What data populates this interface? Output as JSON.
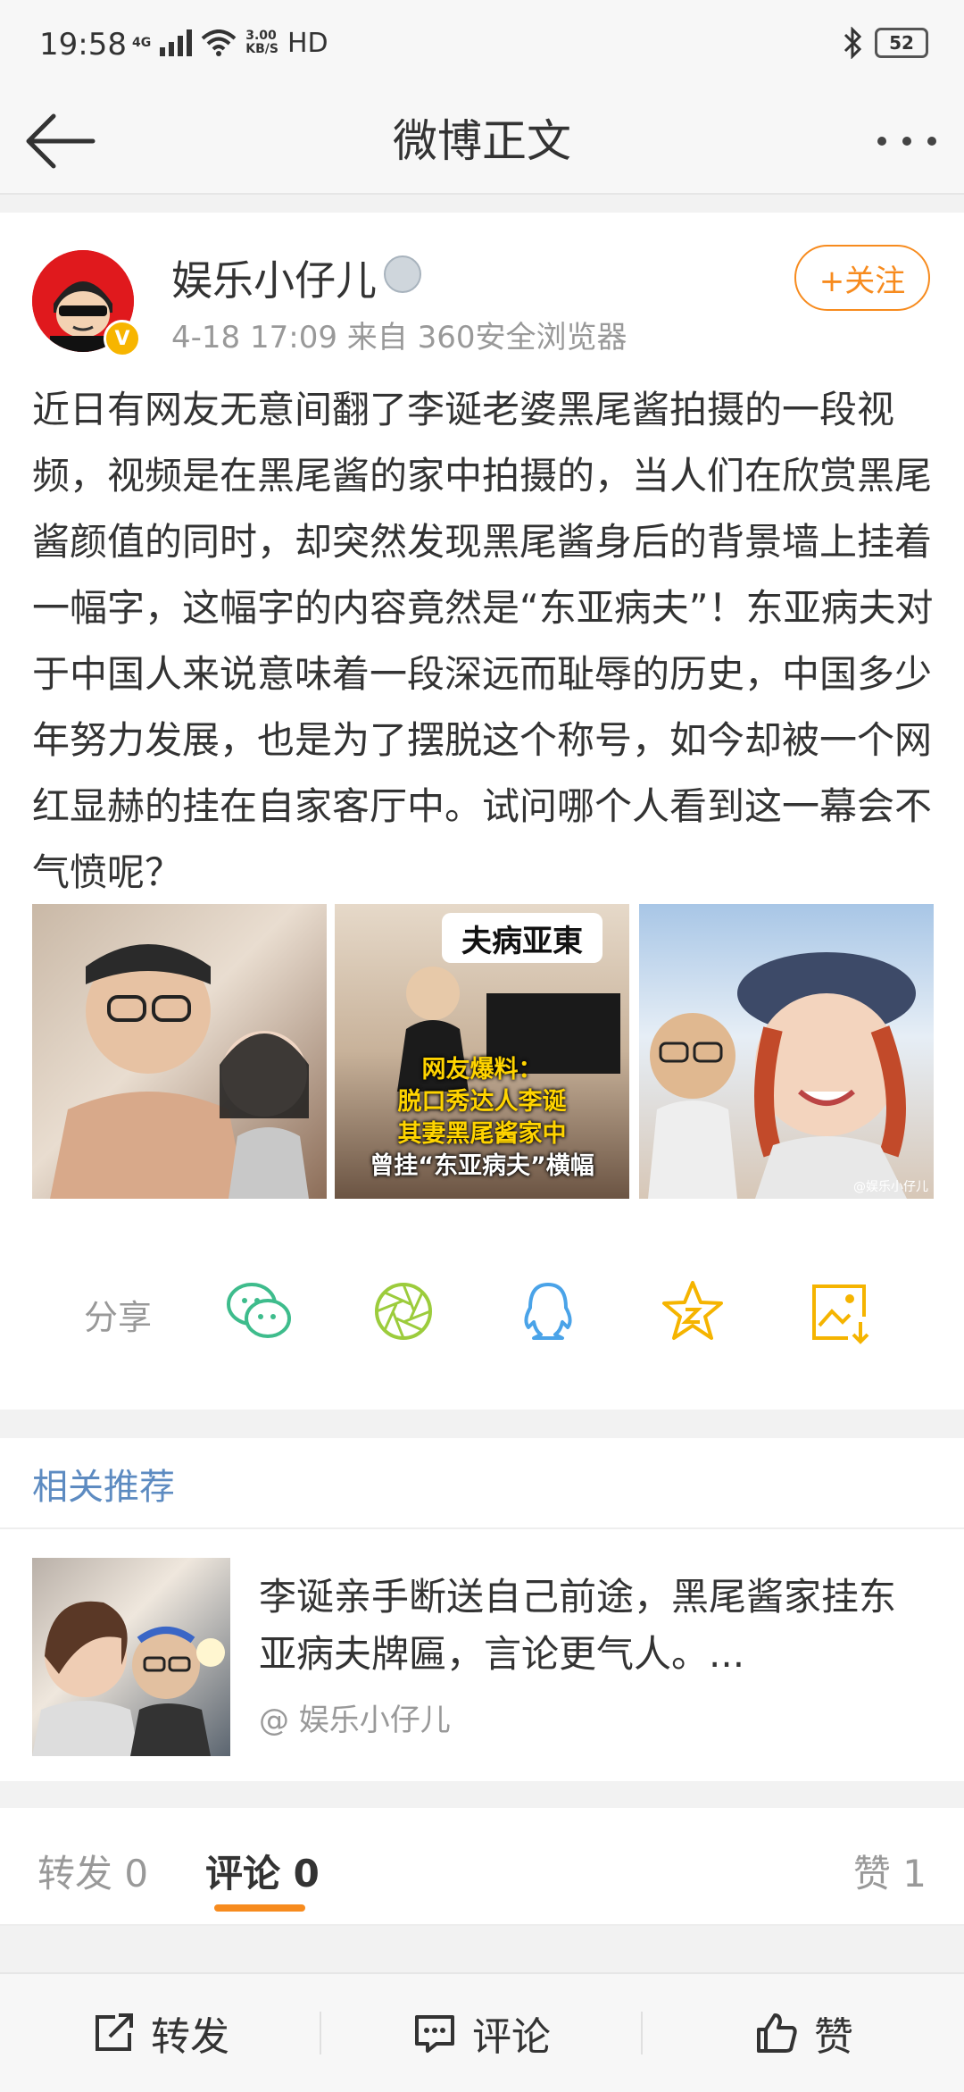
{
  "status_bar": {
    "time": "19:58",
    "network": "4G",
    "speed_value": "3.00",
    "speed_unit": "KB/S",
    "hd": "HD",
    "battery": "52"
  },
  "nav": {
    "title": "微博正文"
  },
  "post": {
    "username": "娱乐小仔儿",
    "meta": "4-18 17:09   来自 360安全浏览器",
    "follow_label": "+关注",
    "text": "近日有网友无意间翻了李诞老婆黑尾酱拍摄的一段视频，视频是在黑尾酱的家中拍摄的，当人们在欣赏黑尾酱颜值的同时，却突然发现黑尾酱身后的背景墙上挂着一幅字，这幅字的内容竟然是“东亚病夫”！东亚病夫对于中国人来说意味着一段深远而耻辱的历史，中国多少年努力发展，也是为了摆脱这个称号，如今却被一个网红显赫的挂在自家客厅中。试问哪个人看到这一幕会不气愤呢？",
    "image2_banner": "夫病亚東",
    "image2_caption": [
      "网友爆料：",
      "脱口秀达人李诞",
      "其妻黑尾酱家中",
      "曾挂“东亚病夫”横幅"
    ],
    "image3_watermark": "@娱乐小仔儿"
  },
  "share": {
    "label": "分享"
  },
  "related": {
    "heading": "相关推荐",
    "title": "李诞亲手断送自己前途，黑尾酱家挂东亚病夫牌匾，言论更气人。...",
    "author": "@ 娱乐小仔儿"
  },
  "tabs": {
    "repost": "转发 0",
    "comment": "评论 0",
    "like": "赞 1"
  },
  "bottom_bar": {
    "repost": "转发",
    "comment": "评论",
    "like": "赞"
  },
  "colors": {
    "accent_orange": "#f78b1e",
    "link_blue": "#5d8bc1",
    "wechat_green": "#3ebc8c",
    "moments_green": "#9ccc3c",
    "qq_blue": "#4aa3e8",
    "star_yellow": "#f5b400"
  }
}
